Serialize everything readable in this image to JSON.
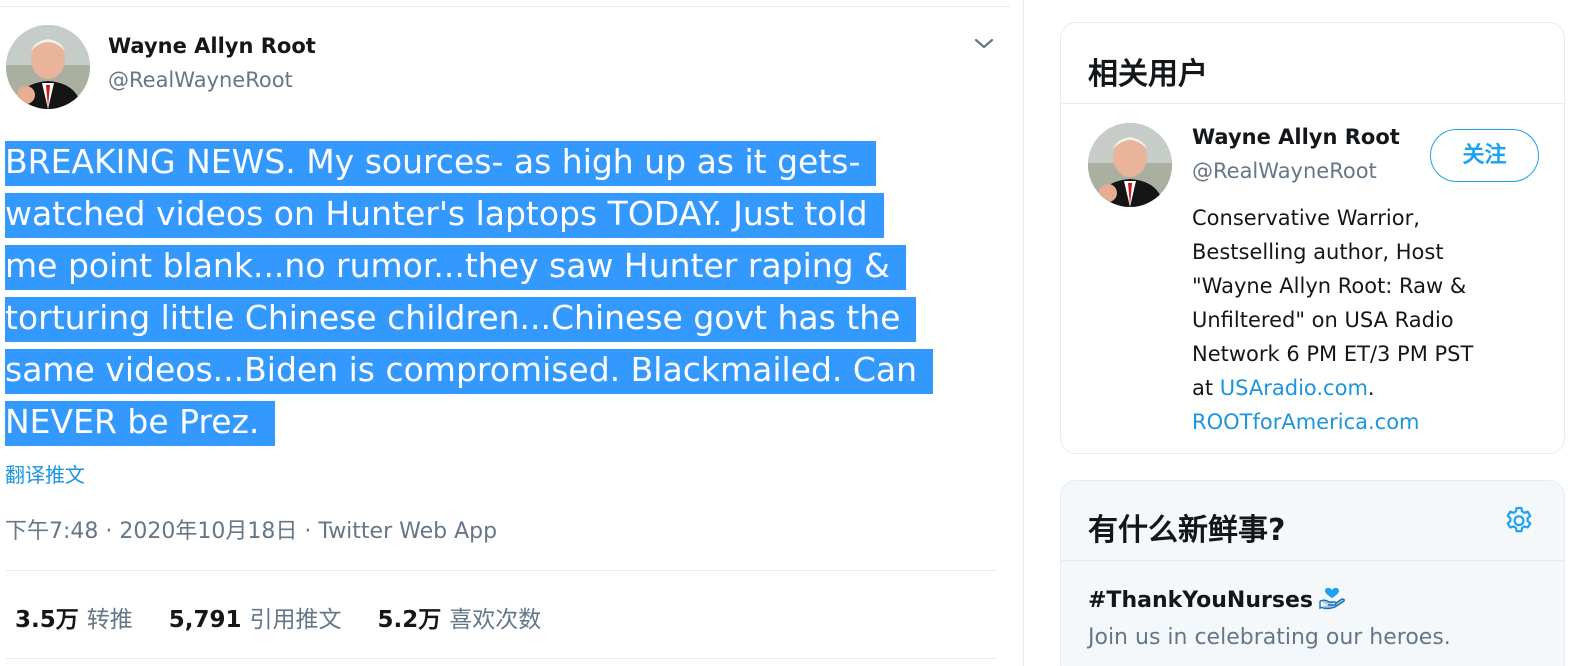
{
  "tweet": {
    "author_name": "Wayne Allyn Root",
    "author_handle": "@RealWayneRoot",
    "text_lines": [
      "BREAKING NEWS. My sources- as high up as it gets-",
      "watched videos on Hunter's laptops TODAY. Just told",
      "me point blank...no rumor...they saw Hunter raping &",
      "torturing little Chinese children...Chinese govt has the",
      "same videos...Biden is compromised. Blackmailed. Can",
      "NEVER be Prez."
    ],
    "translate_label": "翻译推文",
    "time": "下午7:48",
    "date": "2020年10月18日",
    "source": "Twitter Web App",
    "separator": "·",
    "retweets_count": "3.5万",
    "retweets_label": "转推",
    "quotes_count": "5,791",
    "quotes_label": "引用推文",
    "likes_count": "5.2万",
    "likes_label": "喜欢次数",
    "icons": {
      "more": "chevron-down-icon"
    }
  },
  "sidebar": {
    "related": {
      "title": "相关用户",
      "user_name": "Wayne Allyn Root",
      "user_handle": "@RealWayneRoot",
      "follow_label": "关注",
      "bio_lines": [
        "Conservative Warrior,",
        "Bestselling author, Host",
        "\"Wayne Allyn Root: Raw &",
        "Unfiltered\" on USA Radio",
        "Network 6 PM ET/3 PM PST"
      ],
      "bio_at": "at ",
      "bio_link1": "USAradio.com",
      "bio_period": ".",
      "bio_link2": "ROOTforAmerica.com"
    },
    "news": {
      "title": "有什么新鲜事?",
      "trend_tag": "#ThankYouNurses",
      "trend_desc": "Join us in celebrating our heroes.",
      "icons": {
        "settings": "gear-icon",
        "trend": "nurse-heart-emoji"
      }
    }
  },
  "colors": {
    "accent": "#1da1f2",
    "link": "#1b95e0",
    "selection": "#3399ff",
    "muted": "#657786",
    "text": "#14171a"
  }
}
